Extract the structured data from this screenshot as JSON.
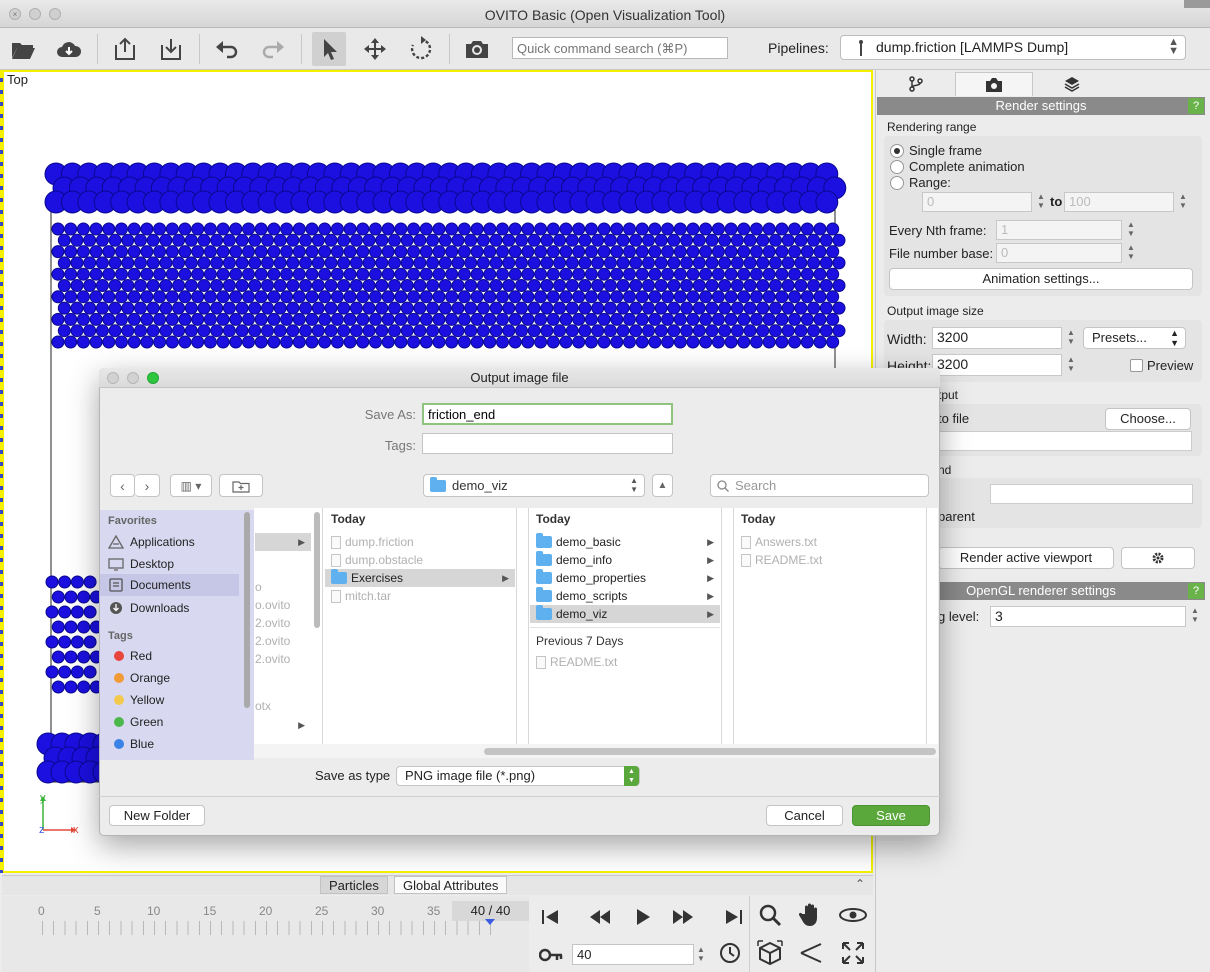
{
  "window": {
    "title": "OVITO Basic (Open Visualization Tool)"
  },
  "toolbar": {
    "search_placeholder": "Quick command search (⌘P)",
    "pipelines_label": "Pipelines:",
    "pipeline_value": "dump.friction [LAMMPS Dump]"
  },
  "viewport": {
    "caption": "Top",
    "axis_x": "x",
    "axis_y": "y",
    "axis_z": "z"
  },
  "panel": {
    "render_settings_title": "Render settings",
    "help": "?",
    "rendering_range_label": "Rendering range",
    "single_frame": "Single frame",
    "complete_animation": "Complete animation",
    "range": "Range:",
    "range_from": "0",
    "range_to_label": "to",
    "range_to": "100",
    "every_nth_label": "Every Nth frame:",
    "every_nth": "1",
    "file_number_base_label": "File number base:",
    "file_number_base": "0",
    "animation_settings": "Animation settings...",
    "output_image_size_label": "Output image size",
    "width_label": "Width:",
    "width": "3200",
    "height_label": "Height:",
    "height": "3200",
    "presets": "Presets...",
    "preview": "Preview",
    "render_output_fragment": "tput",
    "save_to_file_fragment": "to file",
    "choose": "Choose...",
    "background_fragment": "nd",
    "transparent_fragment": "parent",
    "render_active_viewport": "Render active viewport",
    "opengl_title": "OpenGL renderer settings",
    "aa_label_fragment": "g level:",
    "aa_level": "3"
  },
  "bottom": {
    "tab_particles": "Particles",
    "tab_global": "Global Attributes",
    "ticks": [
      "0",
      "5",
      "10",
      "15",
      "20",
      "25",
      "30",
      "35"
    ],
    "frame_display": "40 / 40",
    "current_frame": "40"
  },
  "dialog": {
    "title": "Output image file",
    "save_as_label": "Save As:",
    "save_as_value": "friction_end",
    "tags_label": "Tags:",
    "location": "demo_viz",
    "search_placeholder": "Search",
    "favorites_label": "Favorites",
    "favorites": [
      "Applications",
      "Desktop",
      "Documents",
      "Downloads"
    ],
    "tags_section_label": "Tags",
    "tags": [
      {
        "name": "Red",
        "color": "#e8453c"
      },
      {
        "name": "Orange",
        "color": "#f29a35"
      },
      {
        "name": "Yellow",
        "color": "#f2c94c"
      },
      {
        "name": "Green",
        "color": "#4cb84b"
      },
      {
        "name": "Blue",
        "color": "#3b82e6"
      }
    ],
    "col0_fragments": [
      "o",
      "o.ovito",
      "2.ovito",
      "2.ovito",
      "2.ovito",
      "otx"
    ],
    "col1_head": "Today",
    "col1": [
      "dump.friction",
      "dump.obstacle",
      "Exercises",
      "mitch.tar"
    ],
    "col2_head": "Today",
    "col2": [
      "demo_basic",
      "demo_info",
      "demo_properties",
      "demo_scripts",
      "demo_viz"
    ],
    "col2_prev_head": "Previous 7 Days",
    "col2_prev": [
      "README.txt"
    ],
    "col3_head": "Today",
    "col3": [
      "Answers.txt",
      "README.txt"
    ],
    "save_type_label": "Save as type",
    "save_type_value": "PNG image file (*.png)",
    "new_folder": "New Folder",
    "cancel": "Cancel",
    "save": "Save"
  }
}
